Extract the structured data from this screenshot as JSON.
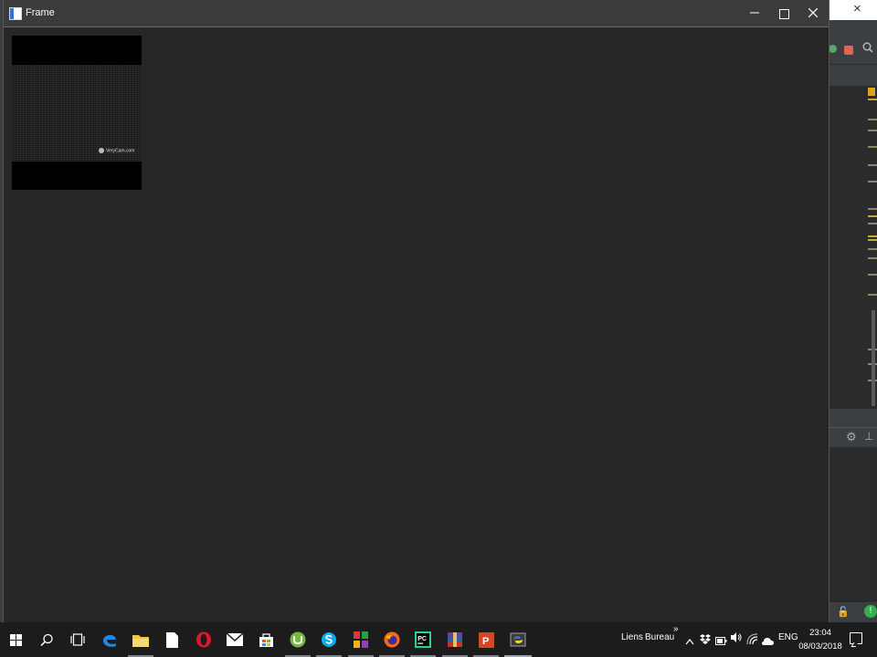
{
  "frame": {
    "title": "Frame",
    "video_watermark": "VeryCam.com"
  },
  "taskbar": {
    "toolbars": [
      "Liens",
      "Bureau"
    ],
    "overflow": "»",
    "language": "ENG",
    "time": "23:04",
    "date": "08/03/2018"
  },
  "ide": {
    "close": "×"
  },
  "colors": {
    "frame_background": "#282624",
    "titlebar": "#3b3b3b",
    "taskbar": "#1c1c1c",
    "ide_marker": "#c8a83a"
  }
}
